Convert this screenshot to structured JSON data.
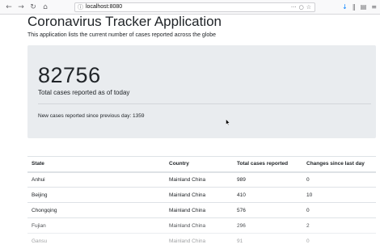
{
  "browser": {
    "back_icon": "back-arrow-icon",
    "forward_icon": "forward-arrow-icon",
    "reload_icon": "reload-icon",
    "home_icon": "home-icon",
    "url": "localhost:8080",
    "toolbar_icons": [
      "downloads-icon",
      "library-icon",
      "sidebar-icon",
      "menu-icon"
    ]
  },
  "page": {
    "title": "Coronavirus Tracker Application",
    "subtitle": "This application lists the current number of cases reported across the globe"
  },
  "summary": {
    "total_cases": "82756",
    "total_caption": "Total cases reported as of today",
    "new_cases_text": "New cases reported since previous day: 1359"
  },
  "table": {
    "headers": [
      "State",
      "Country",
      "Total cases reported",
      "Changes since last day"
    ],
    "rows": [
      [
        "Anhui",
        "Mainland China",
        "989",
        "0"
      ],
      [
        "Beijing",
        "Mainland China",
        "410",
        "10"
      ],
      [
        "Chongqing",
        "Mainland China",
        "576",
        "0"
      ],
      [
        "Fujian",
        "Mainland China",
        "296",
        "2"
      ],
      [
        "Gansu",
        "Mainland China",
        "91",
        "0"
      ]
    ]
  },
  "colors": {
    "jumbotron_bg": "#e9ecef",
    "text": "#212529",
    "border": "#dee2e6"
  }
}
